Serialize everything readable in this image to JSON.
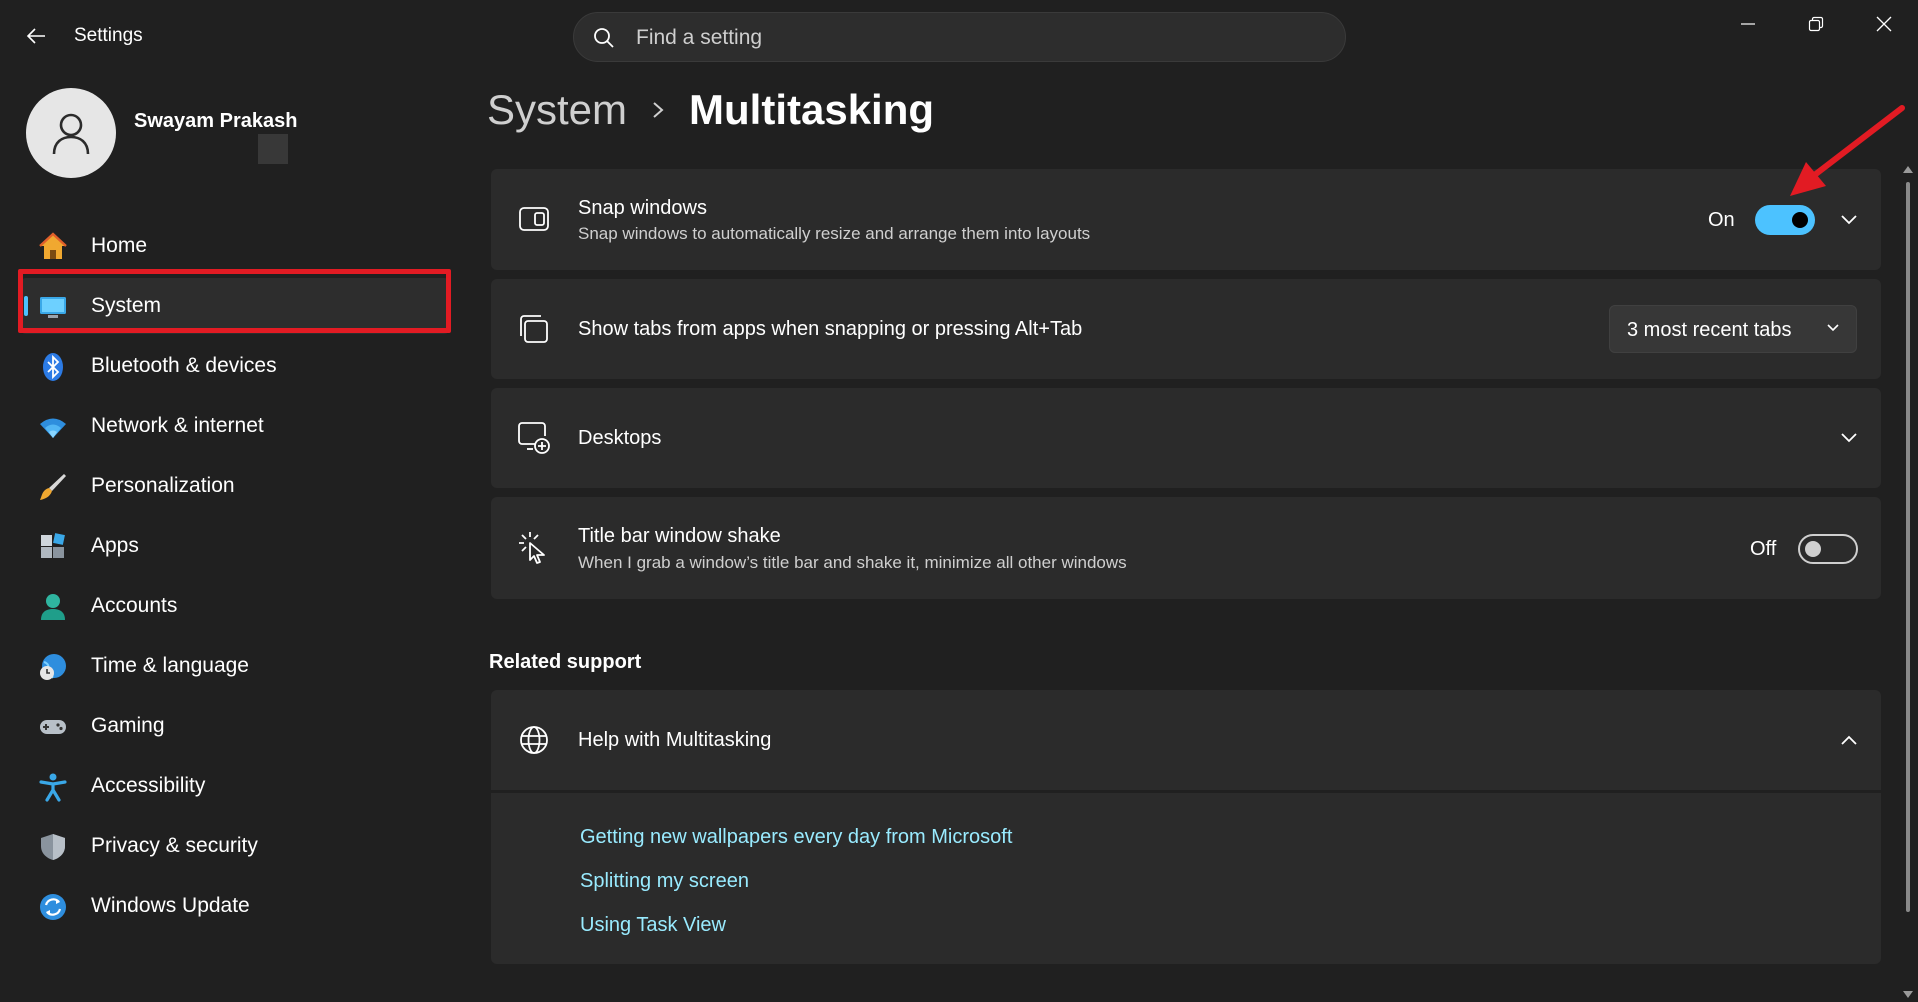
{
  "window": {
    "title": "Settings"
  },
  "search": {
    "placeholder": "Find a setting"
  },
  "user": {
    "name": "Swayam Prakash"
  },
  "sidebar": {
    "items": [
      {
        "label": "Home",
        "icon": "home-icon"
      },
      {
        "label": "System",
        "icon": "monitor-icon",
        "selected": true
      },
      {
        "label": "Bluetooth & devices",
        "icon": "bluetooth-icon"
      },
      {
        "label": "Network & internet",
        "icon": "wifi-icon"
      },
      {
        "label": "Personalization",
        "icon": "brush-icon"
      },
      {
        "label": "Apps",
        "icon": "apps-icon"
      },
      {
        "label": "Accounts",
        "icon": "person-icon"
      },
      {
        "label": "Time & language",
        "icon": "globe-clock-icon"
      },
      {
        "label": "Gaming",
        "icon": "gamepad-icon"
      },
      {
        "label": "Accessibility",
        "icon": "accessibility-icon"
      },
      {
        "label": "Privacy & security",
        "icon": "shield-icon"
      },
      {
        "label": "Windows Update",
        "icon": "update-icon"
      }
    ]
  },
  "breadcrumb": {
    "parent": "System",
    "current": "Multitasking"
  },
  "settings": {
    "snap": {
      "title": "Snap windows",
      "description": "Snap windows to automatically resize and arrange them into layouts",
      "state_label": "On",
      "enabled": true,
      "icon": "snap-layout-icon"
    },
    "tabs": {
      "title": "Show tabs from apps when snapping or pressing Alt+Tab",
      "selected_option": "3 most recent tabs",
      "icon": "tabs-icon"
    },
    "desktops": {
      "title": "Desktops",
      "icon": "desktop-add-icon"
    },
    "shake": {
      "title": "Title bar window shake",
      "description": "When I grab a window’s title bar and shake it, minimize all other windows",
      "state_label": "Off",
      "enabled": false,
      "icon": "cursor-shake-icon"
    }
  },
  "related": {
    "heading": "Related support",
    "help": {
      "title": "Help with Multitasking",
      "expanded": true,
      "links": [
        "Getting new wallpapers every day from Microsoft",
        "Splitting my screen",
        "Using Task View"
      ]
    }
  },
  "colors": {
    "background": "#202020",
    "card": "#2b2b2b",
    "accent": "#4cc2ff",
    "link": "#99ebff",
    "annotation_red": "#e21b23"
  }
}
